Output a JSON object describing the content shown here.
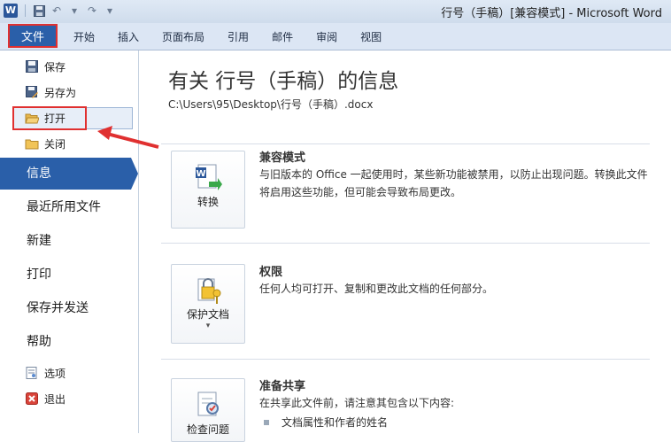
{
  "window": {
    "title": "行号（手稿）[兼容模式] - Microsoft Word",
    "app_icon": "W"
  },
  "ribbon": {
    "file_tab": "文件",
    "tabs": [
      "开始",
      "插入",
      "页面布局",
      "引用",
      "邮件",
      "审阅",
      "视图"
    ]
  },
  "sidebar": {
    "commands": [
      {
        "label": "保存",
        "icon": "save-icon"
      },
      {
        "label": "另存为",
        "icon": "save-as-icon"
      },
      {
        "label": "打开",
        "icon": "open-folder-icon"
      },
      {
        "label": "关闭",
        "icon": "close-folder-icon"
      }
    ],
    "main_items": [
      "信息",
      "最近所用文件",
      "新建",
      "打印",
      "保存并发送",
      "帮助"
    ],
    "active_item": "信息",
    "bottom_commands": [
      {
        "label": "选项",
        "icon": "options-icon"
      },
      {
        "label": "退出",
        "icon": "exit-icon"
      }
    ]
  },
  "info": {
    "title": "有关 行号（手稿）的信息",
    "path": "C:\\Users\\95\\Desktop\\行号（手稿）.docx",
    "sections": [
      {
        "button_label": "转换",
        "heading": "兼容模式",
        "text": "与旧版本的 Office 一起使用时，某些新功能被禁用，以防止出现问题。转换此文件将启用这些功能，但可能会导致布局更改。"
      },
      {
        "button_label": "保护文档",
        "heading": "权限",
        "text": "任何人均可打开、复制和更改此文档的任何部分。"
      },
      {
        "button_label": "检查问题",
        "heading": "准备共享",
        "text": "在共享此文件前，请注意其包含以下内容:",
        "bullets": [
          "文档属性和作者的姓名"
        ]
      }
    ]
  },
  "colors": {
    "accent": "#2a5fa9",
    "annotation": "#e03030"
  }
}
